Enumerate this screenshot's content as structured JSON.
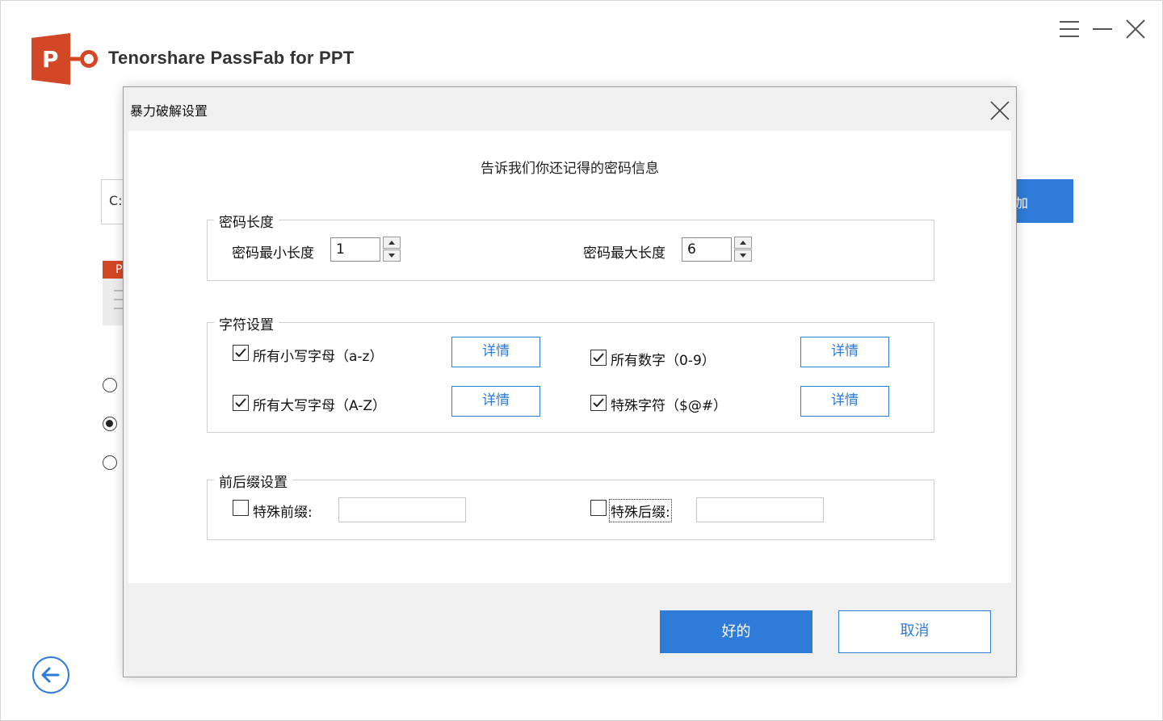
{
  "app": {
    "title": "Tenorshare PassFab for PPT",
    "logo_letter": "P",
    "accent_color": "#2f7bd8",
    "logo_color": "#d24726"
  },
  "window_controls": [
    "menu-icon",
    "minimize-icon",
    "close-icon"
  ],
  "background": {
    "path_prefix": "C:",
    "blue_button_fragment": "加",
    "file_tab_fragment": "P",
    "radio_options": [
      {
        "checked": false
      },
      {
        "checked": true
      },
      {
        "checked": false
      }
    ]
  },
  "dialog": {
    "title": "暴力破解设置",
    "heading": "告诉我们你还记得的密码信息",
    "length_group": {
      "label": "密码长度",
      "min_label": "密码最小长度",
      "min_value": "1",
      "max_label": "密码最大长度",
      "max_value": "6"
    },
    "charset_group": {
      "label": "字符设置",
      "detail_label": "详情",
      "options": [
        {
          "label": "所有小写字母（a-z）",
          "checked": true
        },
        {
          "label": "所有数字（0-9）",
          "checked": true
        },
        {
          "label": "所有大写字母（A-Z）",
          "checked": true
        },
        {
          "label": "特殊字符（$@#）",
          "checked": true
        }
      ]
    },
    "affix_group": {
      "label": "前后缀设置",
      "prefix_label": "特殊前缀:",
      "prefix_checked": false,
      "prefix_value": "",
      "suffix_label": "特殊后缀:",
      "suffix_checked": false,
      "suffix_value": ""
    },
    "ok_label": "好的",
    "cancel_label": "取消"
  }
}
